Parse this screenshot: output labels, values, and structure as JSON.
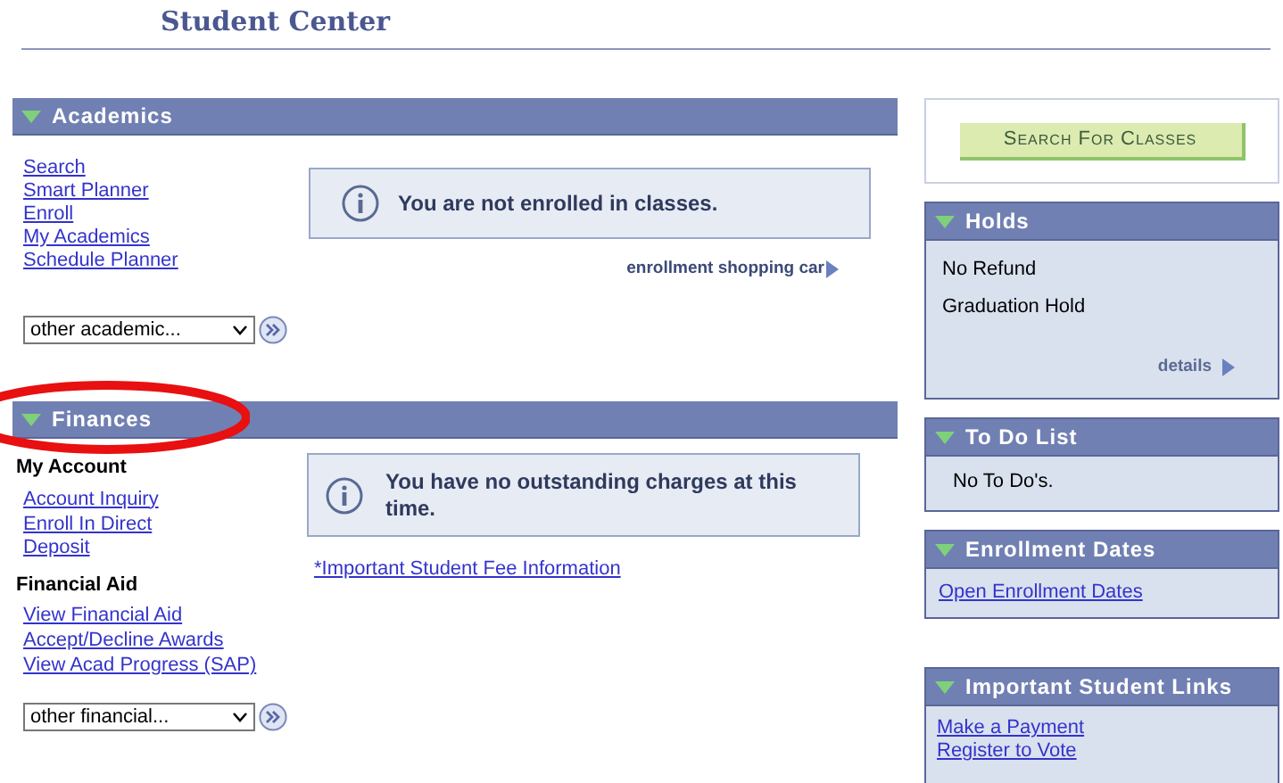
{
  "page_title": "Student Center",
  "academics": {
    "title": "Academics",
    "links": [
      "Search",
      "Smart Planner",
      "Enroll",
      "My Academics",
      "Schedule Planner"
    ],
    "notice": "You are not enrolled in classes.",
    "cart_link": "enrollment shopping car",
    "dropdown": {
      "value": "other academic..."
    }
  },
  "finances": {
    "title": "Finances",
    "groups": [
      {
        "heading": "My Account",
        "links": [
          "Account Inquiry",
          "Enroll In Direct Deposit"
        ]
      },
      {
        "heading": "Financial Aid",
        "links": [
          "View Financial Aid",
          "Accept/Decline Awards",
          "View Acad Progress (SAP)"
        ]
      }
    ],
    "notice": "You have no outstanding charges at this time.",
    "fee_link": "*Important Student Fee Information",
    "dropdown": {
      "value": "other financial..."
    }
  },
  "search_button": "Search For Classes",
  "holds": {
    "title": "Holds",
    "items": [
      "No Refund",
      "Graduation Hold"
    ],
    "details_link": "details"
  },
  "todo": {
    "title": "To Do List",
    "text": "No To Do's."
  },
  "enrollment_dates": {
    "title": "Enrollment Dates",
    "link": "Open Enrollment Dates"
  },
  "student_links": {
    "title": "Important Student Links",
    "links": [
      "Make a Payment",
      "Register to Vote"
    ]
  }
}
